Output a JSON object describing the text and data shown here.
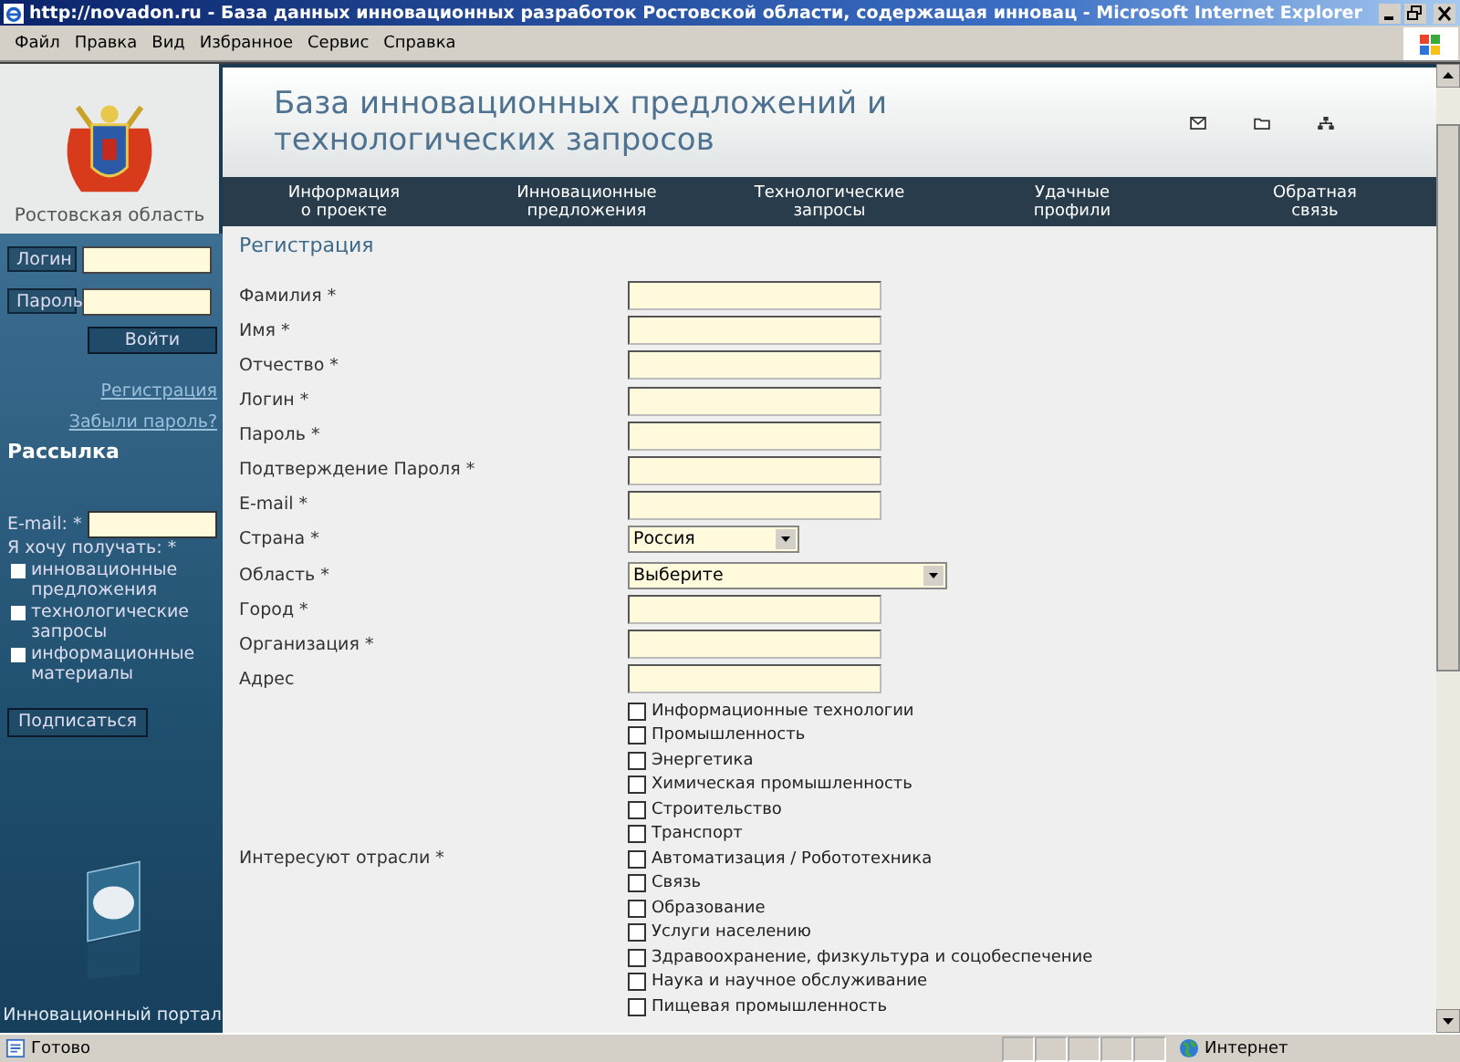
{
  "window": {
    "title": "http://novadon.ru - База данных инновационных разработок Ростовской области, содержащая инновац - Microsoft Internet Explorer"
  },
  "menu": [
    "Файл",
    "Правка",
    "Вид",
    "Избранное",
    "Сервис",
    "Справка"
  ],
  "header": {
    "region": "Ростовская область",
    "title": "База инновационных предложений и\nтехнологических запросов"
  },
  "nav": [
    "Информация\nо проекте",
    "Инновационные\nпредложения",
    "Технологические\nзапросы",
    "Удачные\nпрофили",
    "Обратная\nсвязь"
  ],
  "sidebar": {
    "login_label": "Логин",
    "password_label": "Пароль",
    "login_button": "Войти",
    "links": [
      "Регистрация",
      "Забыли пароль?"
    ],
    "newsletter": {
      "heading": "Рассылка",
      "email_label": "E-mail: *",
      "receive_label": "Я хочу получать: *",
      "options": [
        {
          "label": "инновационные предложения",
          "checked": false
        },
        {
          "label": "технологические запросы",
          "checked": false
        },
        {
          "label": "информационные материалы",
          "checked": false
        }
      ],
      "button": "Подписаться"
    },
    "portal_caption": "Инновационный портал"
  },
  "form": {
    "heading": "Регистрация",
    "fields": [
      {
        "label": "Фамилия *",
        "kind": "text"
      },
      {
        "label": "Имя *",
        "kind": "text"
      },
      {
        "label": "Отчество *",
        "kind": "text"
      },
      {
        "label": "Логин *",
        "kind": "text"
      },
      {
        "label": "Пароль *",
        "kind": "text"
      },
      {
        "label": "Подтверждение Пароля *",
        "kind": "text"
      },
      {
        "label": "E-mail *",
        "kind": "text"
      },
      {
        "label": "Страна *",
        "kind": "select",
        "value": "Россия"
      },
      {
        "label": "Область *",
        "kind": "select-wide",
        "value": "Выберите"
      },
      {
        "label": "Город *",
        "kind": "text"
      },
      {
        "label": "Организация *",
        "kind": "text"
      },
      {
        "label": "Адрес",
        "kind": "text"
      }
    ],
    "industries": {
      "label": "Интересуют отрасли *",
      "options": [
        {
          "label": "Информационные технологии",
          "checked": false
        },
        {
          "label": "Промышленность",
          "checked": false
        },
        {
          "label": "Энергетика",
          "checked": false
        },
        {
          "label": "Химическая промышленность",
          "checked": false
        },
        {
          "label": "Строительство",
          "checked": false
        },
        {
          "label": "Транспорт",
          "checked": false
        },
        {
          "label": "Автоматизация / Робототехника",
          "checked": false
        },
        {
          "label": "Связь",
          "checked": false
        },
        {
          "label": "Образование",
          "checked": false
        },
        {
          "label": "Услуги населению",
          "checked": false
        },
        {
          "label": "Здравоохранение, физкультура и соцобеспечение",
          "checked": false
        },
        {
          "label": "Наука и научное обслуживание",
          "checked": false
        },
        {
          "label": "Пищевая промышленность",
          "checked": false
        }
      ]
    }
  },
  "status_bar": {
    "text": "Готово",
    "zone": "Интернет"
  }
}
